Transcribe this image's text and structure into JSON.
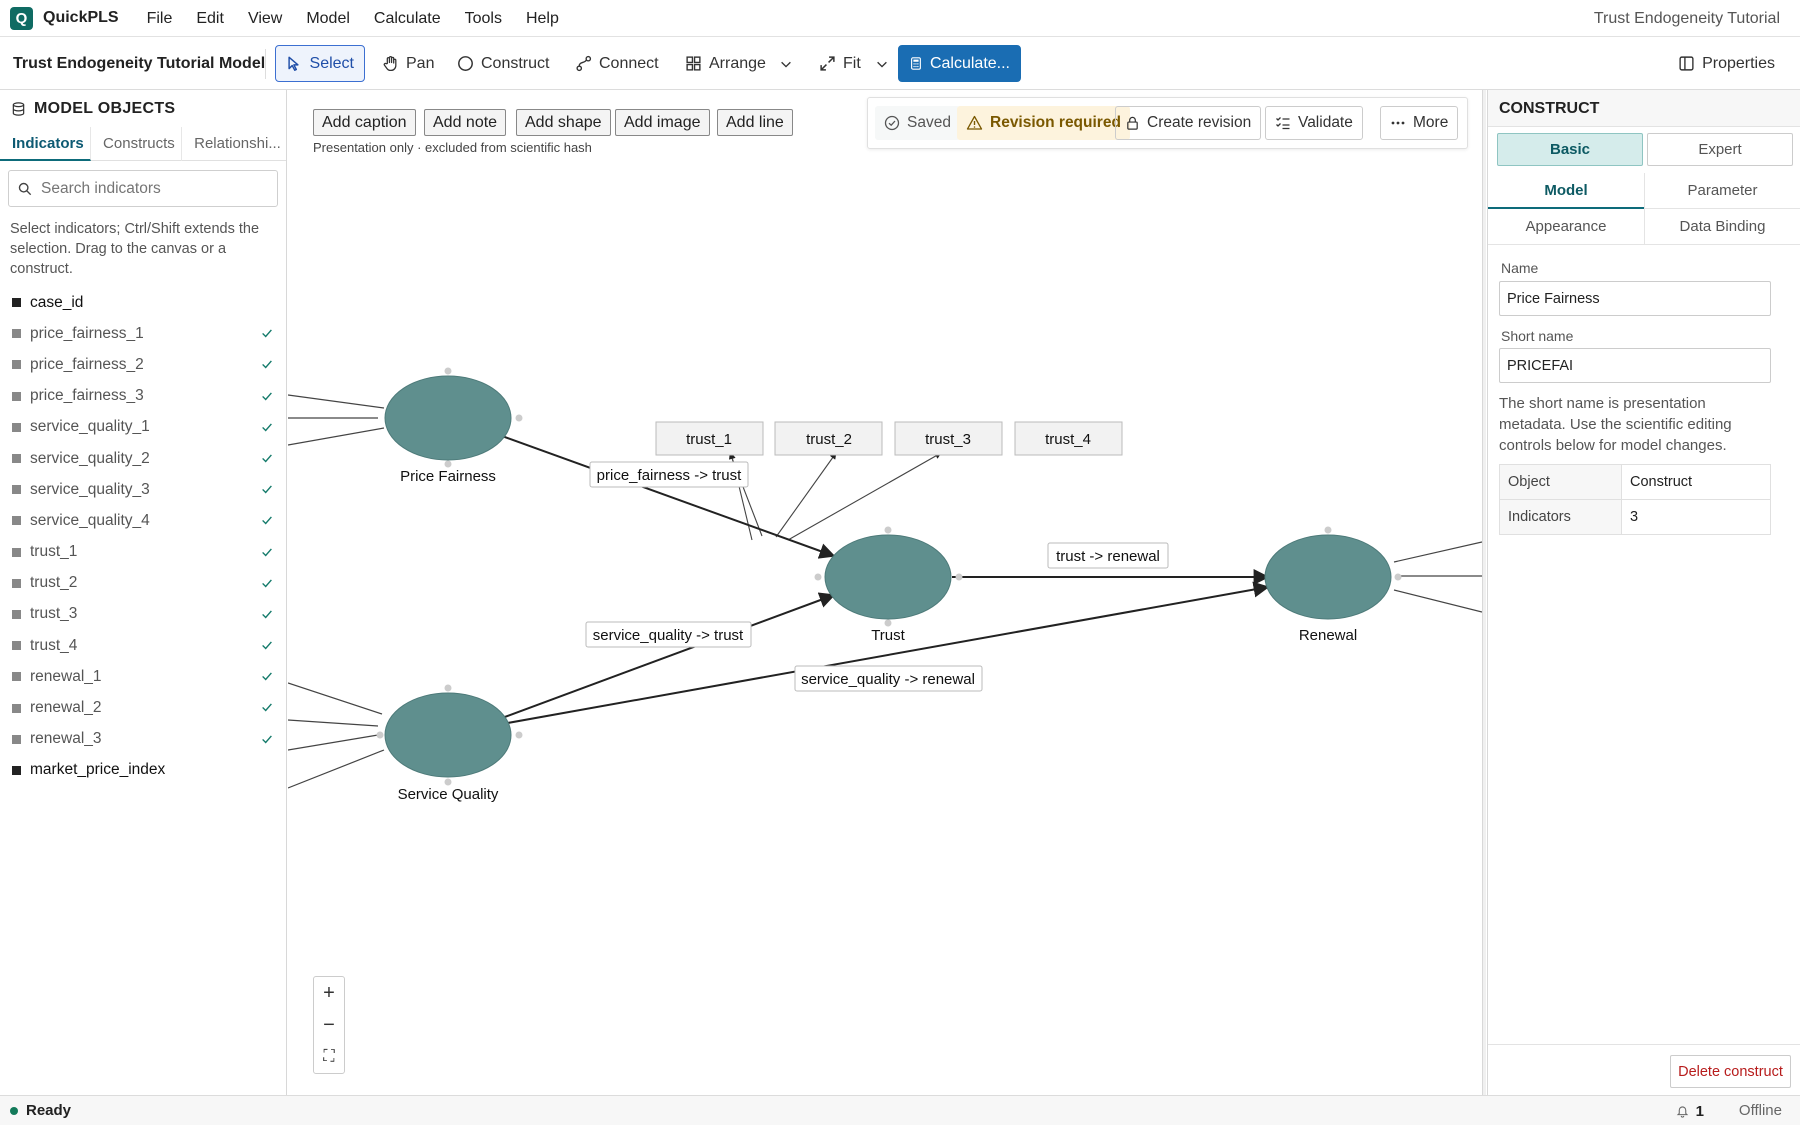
{
  "app": {
    "name": "QuickPLS",
    "logo_letter": "Q",
    "window_title": "Trust Endogeneity Tutorial"
  },
  "menu": [
    "File",
    "Edit",
    "View",
    "Model",
    "Calculate",
    "Tools",
    "Help"
  ],
  "toolbar": {
    "model_title": "Trust Endogeneity Tutorial Model",
    "select": "Select",
    "pan": "Pan",
    "construct": "Construct",
    "connect": "Connect",
    "arrange": "Arrange",
    "fit": "Fit",
    "calculate": "Calculate...",
    "properties": "Properties"
  },
  "left_panel": {
    "title": "MODEL OBJECTS",
    "tabs": [
      "Indicators",
      "Constructs",
      "Relationshi..."
    ],
    "search_placeholder": "Search indicators",
    "hint": "Select indicators; Ctrl/Shift extends the selection. Drag to the canvas or a construct.",
    "indicators": [
      {
        "name": "case_id",
        "used": false
      },
      {
        "name": "price_fairness_1",
        "used": true
      },
      {
        "name": "price_fairness_2",
        "used": true
      },
      {
        "name": "price_fairness_3",
        "used": true
      },
      {
        "name": "service_quality_1",
        "used": true
      },
      {
        "name": "service_quality_2",
        "used": true
      },
      {
        "name": "service_quality_3",
        "used": true
      },
      {
        "name": "service_quality_4",
        "used": true
      },
      {
        "name": "trust_1",
        "used": true
      },
      {
        "name": "trust_2",
        "used": true
      },
      {
        "name": "trust_3",
        "used": true
      },
      {
        "name": "trust_4",
        "used": true
      },
      {
        "name": "renewal_1",
        "used": true
      },
      {
        "name": "renewal_2",
        "used": true
      },
      {
        "name": "renewal_3",
        "used": true
      },
      {
        "name": "market_price_index",
        "used": false
      }
    ]
  },
  "canvas": {
    "add_buttons": [
      "Add caption",
      "Add note",
      "Add shape",
      "Add image",
      "Add line"
    ],
    "presentation_note": "Presentation only · excluded from scientific hash",
    "status": {
      "saved": "Saved",
      "revision": "Revision required",
      "create_revision": "Create revision",
      "validate": "Validate",
      "more": "More"
    },
    "constructs": {
      "price_fairness": "Price Fairness",
      "service_quality": "Service Quality",
      "trust": "Trust",
      "renewal": "Renewal"
    },
    "trust_indicators": [
      "trust_1",
      "trust_2",
      "trust_3",
      "trust_4"
    ],
    "path_labels": {
      "pf_trust": "price_fairness -> trust",
      "sq_trust": "service_quality -> trust",
      "trust_renewal": "trust -> renewal",
      "sq_renewal": "service_quality -> renewal"
    },
    "zoom": {
      "in": "+",
      "out": "−",
      "fit": "⛶"
    },
    "colors": {
      "construct_fill": "#5f8f8e",
      "construct_stroke": "#4d7a79"
    }
  },
  "right_panel": {
    "title": "CONSTRUCT",
    "modes": {
      "basic": "Basic",
      "expert": "Expert"
    },
    "tabs": {
      "model": "Model",
      "parameter": "Parameter",
      "appearance": "Appearance",
      "data_binding": "Data Binding"
    },
    "name_label": "Name",
    "name_value": "Price Fairness",
    "short_name_label": "Short name",
    "short_name_value": "PRICEFAI",
    "help": "The short name is presentation metadata. Use the scientific editing controls below for model changes.",
    "table": [
      {
        "key": "Object",
        "value": "Construct"
      },
      {
        "key": "Indicators",
        "value": "3"
      }
    ],
    "delete": "Delete construct"
  },
  "statusbar": {
    "status": "Ready",
    "notifications": "1",
    "connection": "Offline"
  }
}
